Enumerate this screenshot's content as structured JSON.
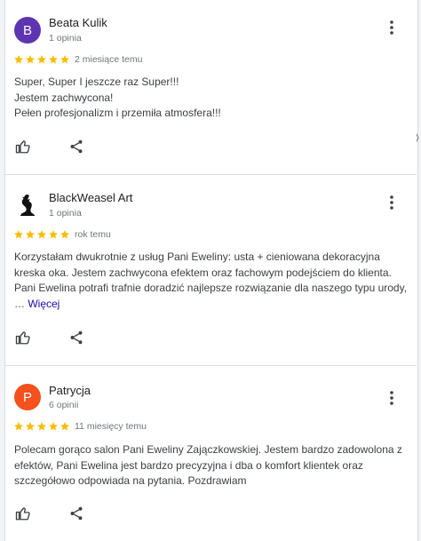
{
  "colors": {
    "star": "#fbbc04",
    "link": "#1a0dab",
    "avatar_b": "#5e35b1",
    "avatar_p": "#f4511e"
  },
  "reviews": [
    {
      "avatar_letter": "B",
      "name": "Beata Kulik",
      "meta": "1 opinia",
      "rating": 5,
      "date": "2 miesiące temu",
      "lines": [
        "Super, Super I jeszcze raz Super!!!",
        "Jestem zachwycona!",
        "Pełen profesjonalizm i przemiła atmosfera!!!"
      ]
    },
    {
      "avatar_icon": "silhouette-logo-icon",
      "name": "BlackWeasel Art",
      "meta": "1 opinia",
      "rating": 5,
      "date": "rok temu",
      "text": "Korzystałam dwukrotnie z usług Pani Eweliny: usta + cieniowana dekoracyjna kreska oka. Jestem zachwycona efektem oraz fachowym podejściem do klienta. Pani Ewelina potrafi trafnie doradzić najlepsze rozwiązanie dla naszego typu urody, …",
      "more_label": "Więcej"
    },
    {
      "avatar_letter": "P",
      "name": "Patrycja",
      "meta": "6 opinii",
      "rating": 5,
      "date": "11 miesięcy temu",
      "text": "Polecam gorąco salon Pani Eweliny Zajączkowskiej. Jestem bardzo zadowolona z efektów, Pani Ewelina jest bardzo precyzyjna i dba o komfort klientek oraz szczegółowo odpowiada na pytania. Pozdrawiam"
    }
  ]
}
